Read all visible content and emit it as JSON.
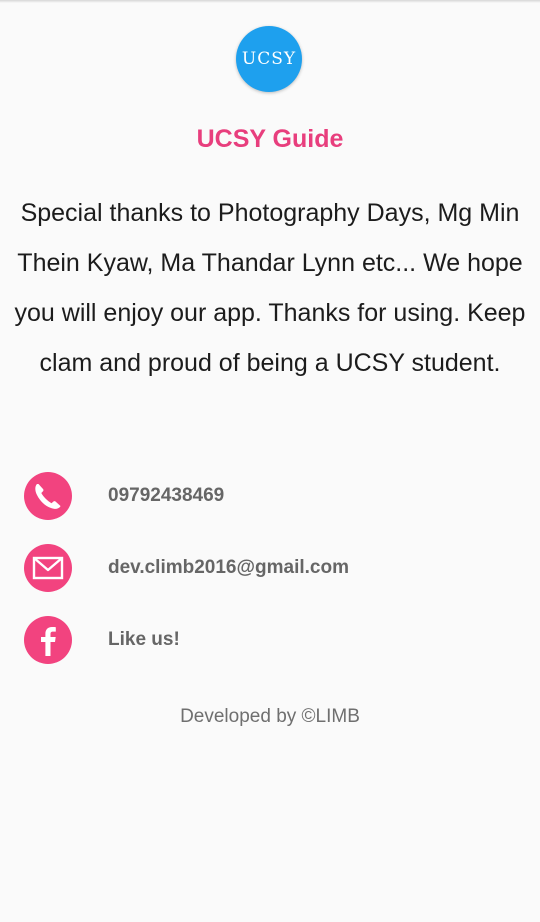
{
  "header": {
    "logo_text": "UCSY",
    "title": "UCSY Guide"
  },
  "about": {
    "text": "Special thanks to Photography Days, Mg Min Thein Kyaw, Ma Thandar Lynn etc... We hope you will enjoy our app. Thanks for using. Keep clam and proud of being a UCSY student."
  },
  "contacts": {
    "phone": {
      "icon": "phone-icon",
      "label": "09792438469"
    },
    "email": {
      "icon": "mail-icon",
      "label": "dev.climb2016@gmail.com"
    },
    "facebook": {
      "icon": "facebook-icon",
      "label": "Like us!"
    }
  },
  "footer": {
    "text": "Developed by ©LIMB"
  },
  "colors": {
    "accent": "#f2437f",
    "title": "#e83e7d",
    "logo": "#1ea0ee"
  }
}
